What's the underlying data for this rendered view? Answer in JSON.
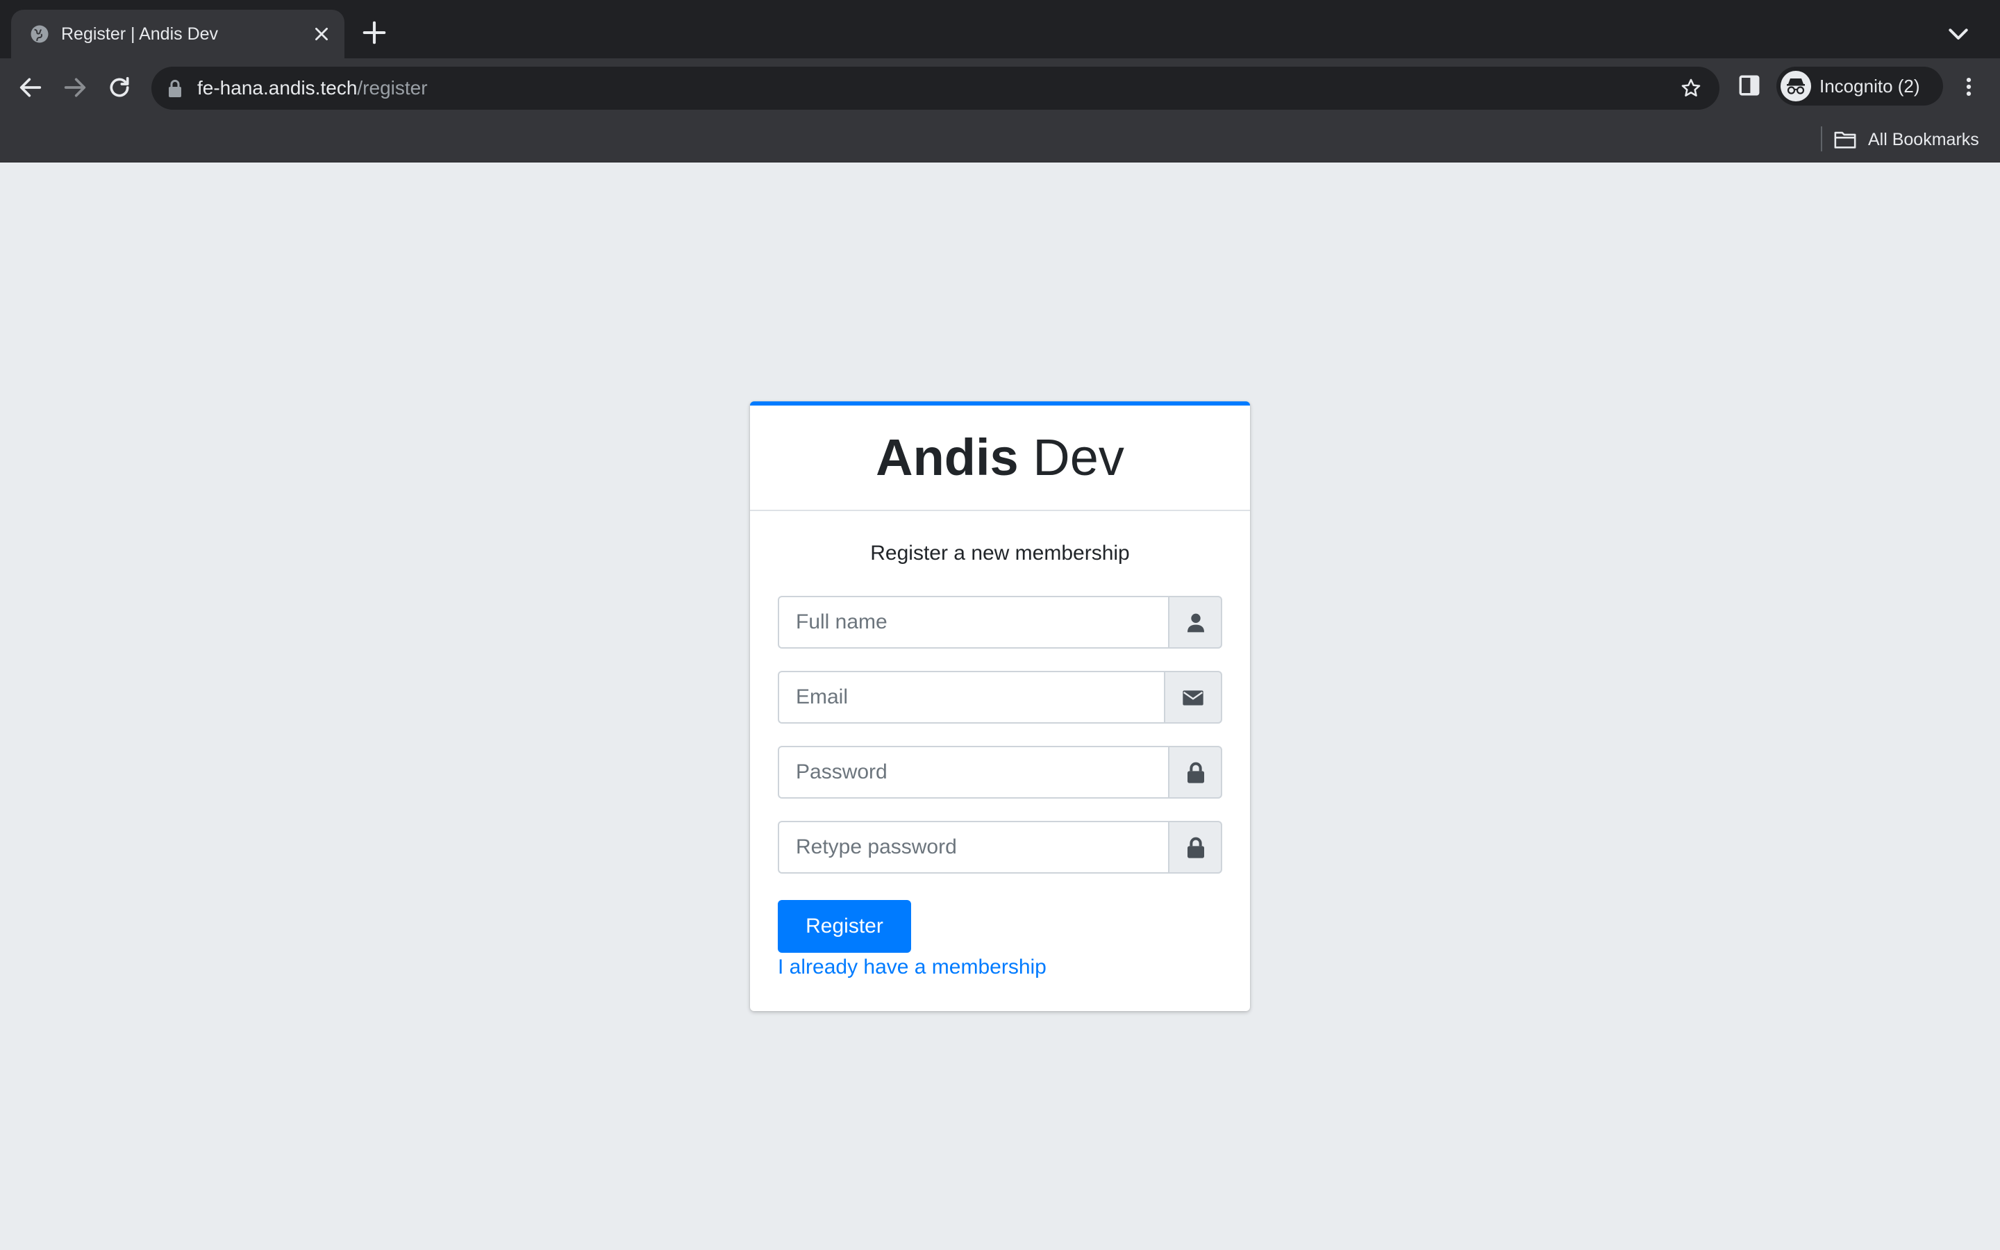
{
  "browser": {
    "tab": {
      "title": "Register | Andis Dev"
    },
    "url": {
      "host": "fe-hana.andis.tech",
      "path": "/register"
    },
    "profile_label": "Incognito (2)",
    "bookmarks": {
      "all_label": "All Bookmarks"
    }
  },
  "page": {
    "brand": {
      "bold": "Andis",
      "light": " Dev"
    },
    "message": "Register a new membership",
    "fields": [
      {
        "placeholder": "Full name",
        "icon": "user-icon"
      },
      {
        "placeholder": "Email",
        "icon": "envelope-icon"
      },
      {
        "placeholder": "Password",
        "icon": "lock-icon"
      },
      {
        "placeholder": "Retype password",
        "icon": "lock-icon"
      }
    ],
    "register_label": "Register",
    "login_link": "I already have a membership"
  },
  "colors": {
    "accent": "#007bff",
    "page_bg": "#e9ecef",
    "chrome_dark": "#202124",
    "chrome_toolbar": "#35363a"
  }
}
